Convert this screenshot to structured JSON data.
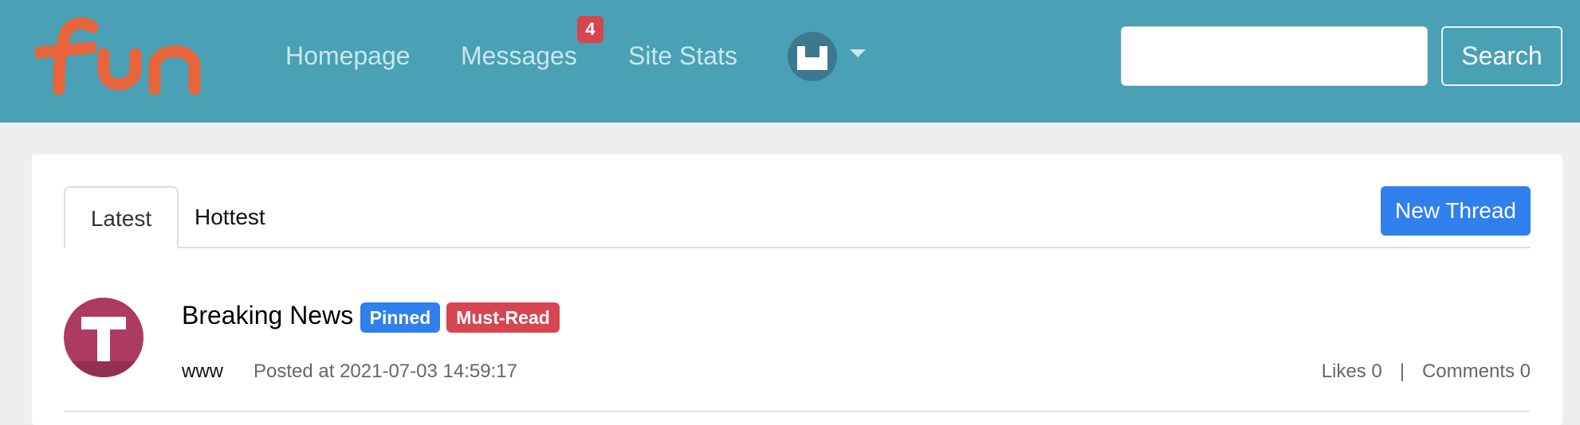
{
  "logo": {
    "text": "fun"
  },
  "nav": {
    "homepage": "Homepage",
    "messages": "Messages",
    "messages_badge": "4",
    "site_stats": "Site Stats"
  },
  "search": {
    "placeholder": "",
    "value": "",
    "button_label": "Search"
  },
  "tabs": [
    {
      "label": "Latest",
      "active": true
    },
    {
      "label": "Hottest",
      "active": false
    }
  ],
  "new_thread_label": "New Thread",
  "posts": [
    {
      "title": "Breaking News",
      "tags": [
        "Pinned",
        "Must-Read"
      ],
      "author": "www",
      "posted_at": "Posted at 2021-07-03 14:59:17",
      "likes": "Likes 0",
      "separator": "|",
      "comments": "Comments 0"
    }
  ],
  "colors": {
    "navbar": "#4aa0b5",
    "logo": "#e8643a",
    "badge": "#d64550",
    "primary": "#2f80ed",
    "danger": "#d64550",
    "post_avatar": "#ad3a62"
  }
}
